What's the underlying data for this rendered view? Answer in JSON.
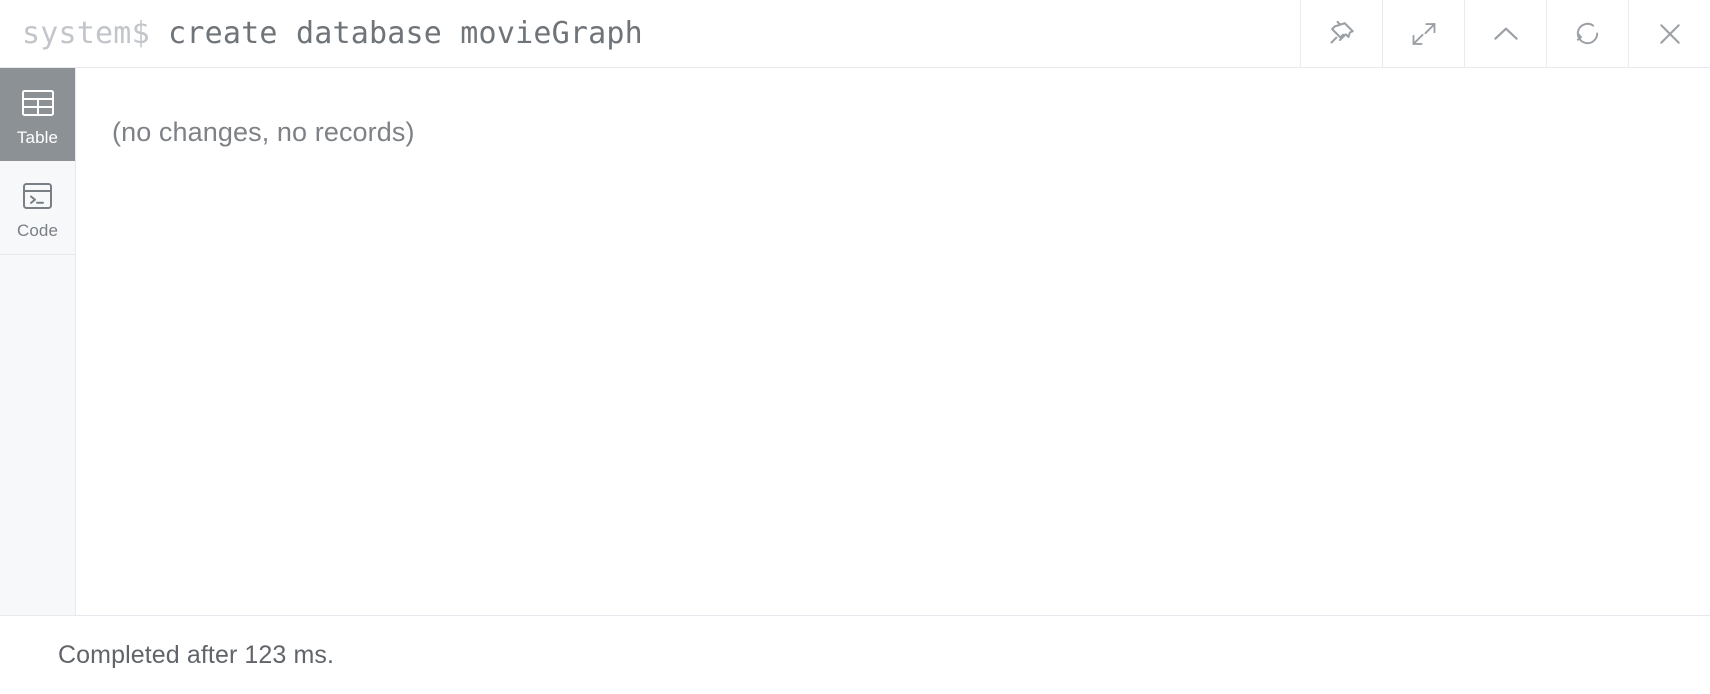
{
  "frame": {
    "command": {
      "prompt": "system$",
      "text": "create database movieGraph"
    }
  },
  "toolbar": {
    "buttons": [
      {
        "name": "pin-icon",
        "label": "Pin"
      },
      {
        "name": "expand-icon",
        "label": "Expand"
      },
      {
        "name": "chevron-up-icon",
        "label": "Collapse"
      },
      {
        "name": "refresh-icon",
        "label": "Rerun"
      },
      {
        "name": "close-icon",
        "label": "Close"
      }
    ]
  },
  "sidebar": {
    "tabs": [
      {
        "label": "Table",
        "icon": "table-icon",
        "active": true
      },
      {
        "label": "Code",
        "icon": "code-icon",
        "active": false
      }
    ]
  },
  "main": {
    "empty_message": "(no changes, no records)"
  },
  "status": {
    "text": "Completed after 123 ms."
  },
  "colors": {
    "active_tab_bg": "#8c9196",
    "sidebar_bg": "#f7f8fa",
    "border": "#e6e9ee",
    "text_muted": "#7e8287",
    "prompt": "#c2c5ca"
  }
}
